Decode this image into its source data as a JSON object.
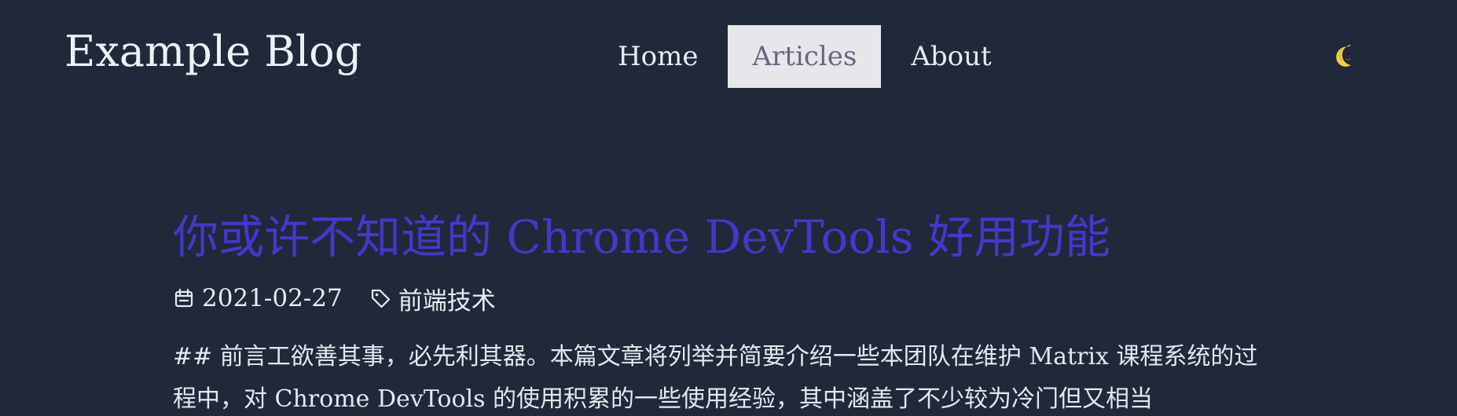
{
  "header": {
    "brand": "Example Blog",
    "nav": [
      {
        "label": "Home",
        "active": false
      },
      {
        "label": "Articles",
        "active": true
      },
      {
        "label": "About",
        "active": false
      }
    ],
    "theme_toggle_icon": "crescent-moon-icon"
  },
  "article": {
    "title": "你或许不知道的 Chrome DevTools 好用功能",
    "date": "2021-02-27",
    "tag": "前端技术",
    "date_icon": "calendar-icon",
    "tag_icon": "tag-icon",
    "excerpt": "## 前言工欲善其事，必先利其器。本篇文章将列举并简要介绍一些本团队在维护 Matrix 课程系统的过程中，对 Chrome DevTools 的使用积累的一些使用经验，其中涵盖了不少较为冷门但又相当"
  },
  "colors": {
    "background": "#202939",
    "title": "#4338ca",
    "nav_active_bg": "#e5e7eb",
    "nav_active_text": "#5f6b80",
    "text": "#e8ebf1"
  }
}
